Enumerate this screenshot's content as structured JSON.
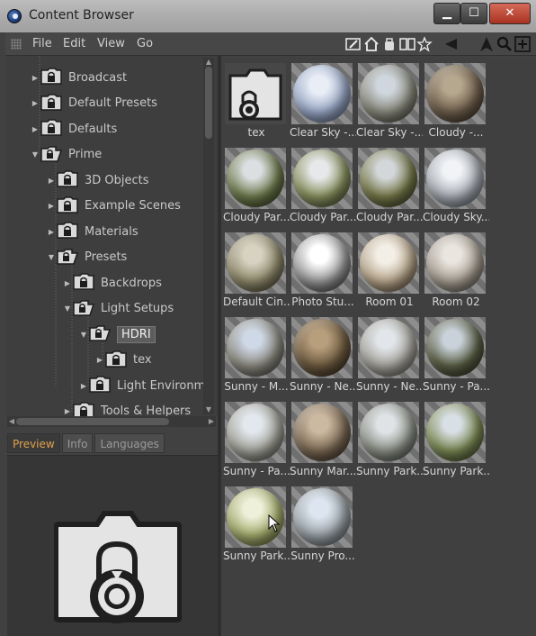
{
  "window": {
    "title": "Content Browser",
    "buttons": {
      "minimize": "▁",
      "maximize": "☐",
      "close": "✕"
    }
  },
  "menu": {
    "items": [
      "File",
      "Edit",
      "View",
      "Go"
    ]
  },
  "toolbar_icons": [
    "edit-icon",
    "home-icon",
    "bag-icon",
    "book-icon",
    "star-icon",
    "back-arrow-icon",
    "up-arrow-icon",
    "search-icon",
    "add-icon"
  ],
  "tree": {
    "items": [
      {
        "label": "Broadcast",
        "level": 1,
        "expanded": false
      },
      {
        "label": "Default Presets",
        "level": 1,
        "expanded": false
      },
      {
        "label": "Defaults",
        "level": 1,
        "expanded": false
      },
      {
        "label": "Prime",
        "level": 1,
        "expanded": true
      },
      {
        "label": "3D Objects",
        "level": 2,
        "expanded": false
      },
      {
        "label": "Example Scenes",
        "level": 2,
        "expanded": false
      },
      {
        "label": "Materials",
        "level": 2,
        "expanded": false
      },
      {
        "label": "Presets",
        "level": 2,
        "expanded": true
      },
      {
        "label": "Backdrops",
        "level": 3,
        "expanded": false
      },
      {
        "label": "Light Setups",
        "level": 3,
        "expanded": true
      },
      {
        "label": "HDRI",
        "level": 4,
        "expanded": true,
        "selected": true
      },
      {
        "label": "tex",
        "level": 5,
        "expanded": false
      },
      {
        "label": "Light Environme",
        "level": 4,
        "expanded": false
      },
      {
        "label": "Tools & Helpers",
        "level": 3,
        "expanded": false
      }
    ]
  },
  "bottom_tabs": [
    {
      "label": "Preview",
      "active": true
    },
    {
      "label": "Info",
      "active": false
    },
    {
      "label": "Languages",
      "active": false
    }
  ],
  "grid": {
    "items": [
      {
        "label": "tex",
        "kind": "folder"
      },
      {
        "label": "Clear Sky -...",
        "kind": "hdri",
        "colors": [
          "#e9eef6",
          "#9aa8c6",
          "#5f6b86"
        ]
      },
      {
        "label": "Clear Sky -...",
        "kind": "hdri",
        "colors": [
          "#cfd6dd",
          "#8a8b7e",
          "#4d4a40"
        ]
      },
      {
        "label": "Cloudy -...",
        "kind": "hdri",
        "colors": [
          "#b6a78f",
          "#6f5f4c",
          "#3a3024"
        ]
      },
      {
        "label": "Cloudy Par...",
        "kind": "hdri",
        "colors": [
          "#dcdfe2",
          "#6f7b4e",
          "#343b22"
        ]
      },
      {
        "label": "Cloudy Par...",
        "kind": "hdri",
        "colors": [
          "#e6e8ea",
          "#88915f",
          "#485032"
        ]
      },
      {
        "label": "Cloudy Par...",
        "kind": "hdri",
        "colors": [
          "#d4d7da",
          "#767a4a",
          "#3d4024"
        ]
      },
      {
        "label": "Cloudy Sky...",
        "kind": "hdri",
        "colors": [
          "#f1f3f6",
          "#a8adb4",
          "#5e646c"
        ]
      },
      {
        "label": "Default Cin...",
        "kind": "hdri",
        "colors": [
          "#d8d2c2",
          "#8f8a6c",
          "#4c4836"
        ]
      },
      {
        "label": "Photo Stu...",
        "kind": "hdri",
        "colors": [
          "#ffffff",
          "#9a9a9a",
          "#3a3a3a"
        ]
      },
      {
        "label": "Room 01",
        "kind": "hdri",
        "colors": [
          "#f3efe7",
          "#b9a88e",
          "#5e4e3a"
        ]
      },
      {
        "label": "Room 02",
        "kind": "hdri",
        "colors": [
          "#e9e5df",
          "#a79f93",
          "#5b554c"
        ]
      },
      {
        "label": "Sunny - M...",
        "kind": "hdri",
        "colors": [
          "#cfd8e6",
          "#8b8a80",
          "#4e4b45"
        ]
      },
      {
        "label": "Sunny - Ne...",
        "kind": "hdri",
        "colors": [
          "#b79e7c",
          "#6d5a40",
          "#32281b"
        ]
      },
      {
        "label": "Sunny - Ne...",
        "kind": "hdri",
        "colors": [
          "#e2e6ea",
          "#a5a39c",
          "#5f5c57"
        ]
      },
      {
        "label": "Sunny - Pa...",
        "kind": "hdri",
        "colors": [
          "#c9d2da",
          "#5b6046",
          "#2c2f20"
        ]
      },
      {
        "label": "Sunny - Pa...",
        "kind": "hdri",
        "colors": [
          "#e3e8ee",
          "#a3a49a",
          "#55564f"
        ]
      },
      {
        "label": "Sunny Mar...",
        "kind": "hdri",
        "colors": [
          "#cbb9a1",
          "#7c6a55",
          "#3a2f24"
        ]
      },
      {
        "label": "Sunny Park...",
        "kind": "hdri",
        "colors": [
          "#dfe3e6",
          "#8e9289",
          "#4b4e47"
        ]
      },
      {
        "label": "Sunny Park...",
        "kind": "hdri",
        "colors": [
          "#d8dfe5",
          "#7c8a55",
          "#3c4428"
        ]
      },
      {
        "label": "Sunny Park...",
        "kind": "hdri",
        "colors": [
          "#eef0da",
          "#a5ac6e",
          "#5b6236"
        ]
      },
      {
        "label": "Sunny Pro...",
        "kind": "hdri",
        "colors": [
          "#dde6f0",
          "#9ba3a8",
          "#5a5f63"
        ]
      }
    ]
  }
}
